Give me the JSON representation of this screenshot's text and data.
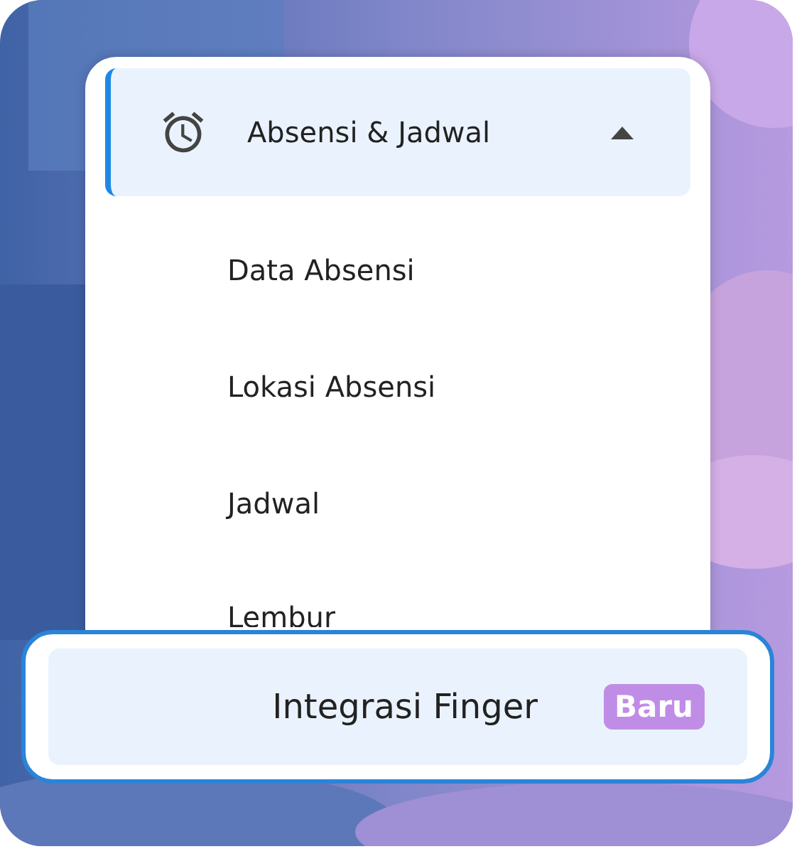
{
  "menu": {
    "group": {
      "label": "Absensi & Jadwal",
      "expanded": true,
      "selected": true
    },
    "items": [
      {
        "label": "Data Absensi"
      },
      {
        "label": "Lokasi Absensi"
      },
      {
        "label": "Jadwal"
      },
      {
        "label": "Lembur"
      }
    ]
  },
  "highlight": {
    "label": "Integrasi Finger",
    "badge": "Baru"
  }
}
